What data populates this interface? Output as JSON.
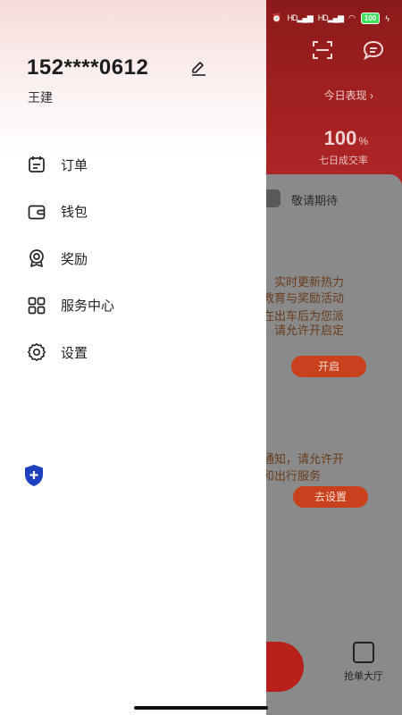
{
  "status_bar": {
    "network_labels": [
      "HD",
      "HD"
    ],
    "battery": "100"
  },
  "drawer": {
    "phone": "152****0612",
    "user_name": "王建",
    "menu": [
      {
        "label": "订单",
        "icon": "order-icon"
      },
      {
        "label": "钱包",
        "icon": "wallet-icon"
      },
      {
        "label": "奖励",
        "icon": "reward-icon"
      },
      {
        "label": "服务中心",
        "icon": "service-center-icon"
      },
      {
        "label": "设置",
        "icon": "settings-icon"
      }
    ]
  },
  "background": {
    "today_link": "今日表现 ›",
    "rate_value": "100",
    "rate_unit": "%",
    "rate_label": "七日成交率",
    "card_title": "敬请期待",
    "notice1": [
      "、实时更新热力",
      "教育与奖励活动",
      "在出车后为您派",
      "，请允许开启定"
    ],
    "open_button": "开启",
    "notice2": [
      "通知，请允许开",
      "和出行服务"
    ],
    "settings_button": "去设置",
    "bottom_tab": "抢单大厅"
  },
  "colors": {
    "accent_red": "#a32121",
    "shield_blue": "#1e3fbf"
  }
}
